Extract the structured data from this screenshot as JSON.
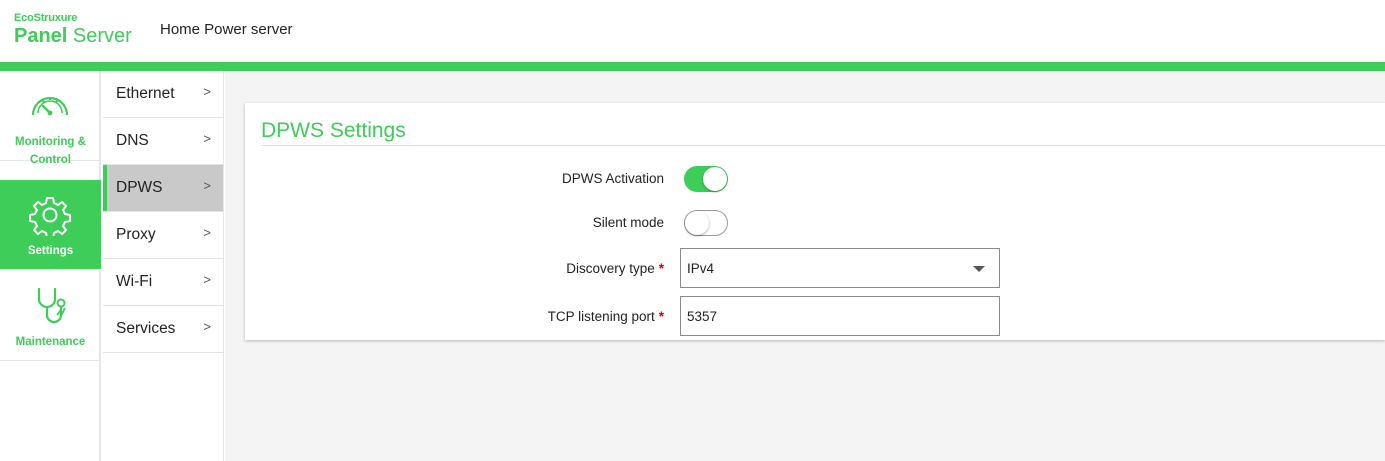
{
  "header": {
    "brand_top": "EcoStruxure",
    "brand_main_bold": "Panel",
    "brand_main_rest": "Server",
    "app_title": "Home Power server"
  },
  "colors": {
    "accent": "#3dcd58",
    "required": "#d10000",
    "active_submenu": "#c9c9c9"
  },
  "rail": {
    "items": [
      {
        "label_line1": "Monitoring &",
        "label_line2": "Control",
        "icon": "gauge-icon",
        "active": false
      },
      {
        "label": "Settings",
        "icon": "gear-icon",
        "active": true
      },
      {
        "label": "Maintenance",
        "icon": "stethoscope-icon",
        "active": false
      }
    ]
  },
  "submenu": {
    "items": [
      {
        "label": "Ethernet",
        "active": false
      },
      {
        "label": "DNS",
        "active": false
      },
      {
        "label": "DPWS",
        "active": true
      },
      {
        "label": "Proxy",
        "active": false
      },
      {
        "label": "Wi-Fi",
        "active": false
      },
      {
        "label": "Services",
        "active": false
      }
    ],
    "chevron": ">"
  },
  "card": {
    "title": "DPWS Settings",
    "dpws_activation": {
      "label": "DPWS Activation",
      "on": true
    },
    "silent_mode": {
      "label": "Silent mode",
      "on": false
    },
    "discovery_type": {
      "label": "Discovery type",
      "required_mark": "*",
      "value": "IPv4"
    },
    "tcp_port": {
      "label": "TCP listening port",
      "required_mark": "*",
      "value": "5357"
    }
  }
}
